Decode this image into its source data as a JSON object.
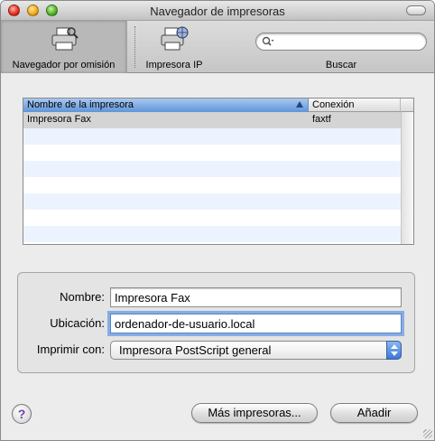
{
  "window": {
    "title": "Navegador de impresoras"
  },
  "toolbar": {
    "items": [
      {
        "label": "Navegador por omisión",
        "icon": "printer-icon",
        "selected": true
      },
      {
        "label": "Impresora IP",
        "icon": "network-printer-icon",
        "selected": false
      }
    ],
    "search": {
      "label": "Buscar",
      "value": "",
      "placeholder": ""
    }
  },
  "printer_list": {
    "columns": [
      "Nombre de la impresora",
      "Conexión"
    ],
    "rows": [
      {
        "name": "Impresora Fax",
        "connection": "faxtf",
        "selected": true
      }
    ]
  },
  "details": {
    "name_label": "Nombre:",
    "name_value": "Impresora Fax",
    "location_label": "Ubicación:",
    "location_value": "ordenador-de-usuario.local",
    "print_with_label": "Imprimir con:",
    "print_with_value": "Impresora PostScript general"
  },
  "buttons": {
    "help": "?",
    "more_printers": "Más impresoras...",
    "add": "Añadir"
  },
  "colors": {
    "accent": "#5f95d9",
    "focus_ring": "#86aee6",
    "row_alt": "#edf3fe"
  }
}
